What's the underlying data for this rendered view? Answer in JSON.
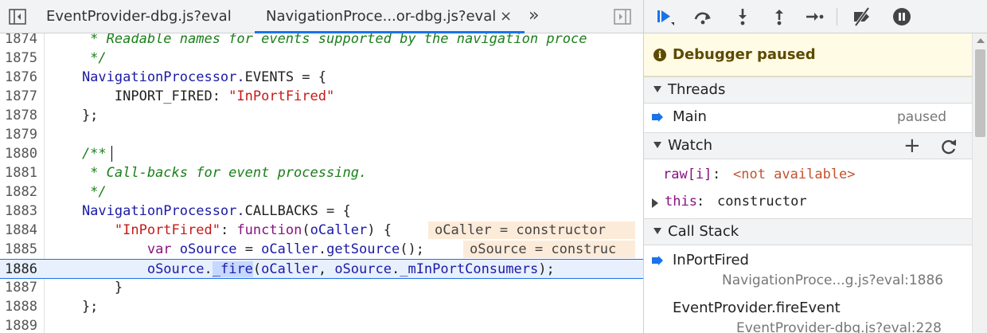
{
  "editor": {
    "tabs": [
      {
        "label": "EventProvider-dbg.js?eval",
        "active": false
      },
      {
        "label": "NavigationProce...or-dbg.js?eval",
        "active": true
      }
    ],
    "close_glyph": "×",
    "more_glyph": "»",
    "lines": [
      {
        "num": "1874",
        "segments": [
          {
            "t": "     * Readable names for events supported by the navigation proce",
            "c": "c-comment"
          }
        ]
      },
      {
        "num": "1875",
        "segments": [
          {
            "t": "     */",
            "c": "c-comment"
          }
        ]
      },
      {
        "num": "1876",
        "segments": [
          {
            "t": "    NavigationProcessor.",
            "c": "c-prop"
          },
          {
            "t": "EVENTS",
            "c": ""
          },
          {
            "t": " = {",
            "c": ""
          }
        ]
      },
      {
        "num": "1877",
        "segments": [
          {
            "t": "        INPORT_FIRED: ",
            "c": ""
          },
          {
            "t": "\"InPortFired\"",
            "c": "c-string"
          }
        ]
      },
      {
        "num": "1878",
        "segments": [
          {
            "t": "    };",
            "c": ""
          }
        ]
      },
      {
        "num": "1879",
        "segments": []
      },
      {
        "num": "1880",
        "segments": [
          {
            "t": "    /**",
            "c": "c-comment"
          }
        ]
      },
      {
        "num": "1881",
        "segments": [
          {
            "t": "     * Call-backs for event processing.",
            "c": "c-comment"
          }
        ]
      },
      {
        "num": "1882",
        "segments": [
          {
            "t": "     */",
            "c": "c-comment"
          }
        ]
      },
      {
        "num": "1883",
        "segments": [
          {
            "t": "    NavigationProcessor.",
            "c": "c-prop"
          },
          {
            "t": "CALLBACKS",
            "c": ""
          },
          {
            "t": " = {",
            "c": ""
          }
        ]
      },
      {
        "num": "1884",
        "segments": [
          {
            "t": "        ",
            "c": ""
          },
          {
            "t": "\"InPortFired\"",
            "c": "c-string"
          },
          {
            "t": ": ",
            "c": ""
          },
          {
            "t": "function",
            "c": "c-keyword"
          },
          {
            "t": "(",
            "c": ""
          },
          {
            "t": "oCaller",
            "c": "c-var"
          },
          {
            "t": ") {",
            "c": ""
          }
        ]
      },
      {
        "num": "1885",
        "segments": [
          {
            "t": "            ",
            "c": ""
          },
          {
            "t": "var",
            "c": "c-keyword"
          },
          {
            "t": " ",
            "c": ""
          },
          {
            "t": "oSource",
            "c": "c-var"
          },
          {
            "t": " = ",
            "c": ""
          },
          {
            "t": "oCaller",
            "c": "c-var"
          },
          {
            "t": ".",
            "c": ""
          },
          {
            "t": "getSource",
            "c": "c-fn"
          },
          {
            "t": "();",
            "c": ""
          }
        ]
      },
      {
        "num": "1886",
        "segments": [
          {
            "t": "            ",
            "c": ""
          },
          {
            "t": "oSource",
            "c": "c-var"
          },
          {
            "t": ".",
            "c": ""
          },
          {
            "t": "_fire",
            "c": "c-fn hl-token"
          },
          {
            "t": "(",
            "c": ""
          },
          {
            "t": "oCaller",
            "c": "c-var"
          },
          {
            "t": ", ",
            "c": ""
          },
          {
            "t": "oSource",
            "c": "c-var"
          },
          {
            "t": ".",
            "c": ""
          },
          {
            "t": "_mInPortConsumers",
            "c": "c-fn"
          },
          {
            "t": ");",
            "c": ""
          }
        ]
      },
      {
        "num": "1887",
        "segments": [
          {
            "t": "        }",
            "c": ""
          }
        ]
      },
      {
        "num": "1888",
        "segments": [
          {
            "t": "    };",
            "c": ""
          }
        ]
      },
      {
        "num": "1889",
        "segments": []
      }
    ],
    "current_line": "1886",
    "inline_values": [
      {
        "line": "1884",
        "text": "oCaller = constructor"
      },
      {
        "line": "1885",
        "text": "oSource = construc"
      }
    ]
  },
  "debugger": {
    "banner": "Debugger paused",
    "banner_icon": "i",
    "threads": {
      "header": "Threads",
      "items": [
        {
          "name": "Main",
          "status": "paused"
        }
      ]
    },
    "watch": {
      "header": "Watch",
      "add_glyph": "+",
      "items": [
        {
          "name": "raw[i]",
          "sep": ": ",
          "value": "<not available>",
          "expandable": false
        },
        {
          "name": "this",
          "sep": ": ",
          "value": "constructor",
          "expandable": true
        }
      ]
    },
    "call_stack": {
      "header": "Call Stack",
      "frames": [
        {
          "fn": "InPortFired",
          "location": "NavigationProce...g.js?eval:1886",
          "current": true
        },
        {
          "fn": "EventProvider.fireEvent",
          "location": "EventProvider-dbg.js?eval:228",
          "current": false
        }
      ]
    }
  },
  "colors": {
    "accent": "#1a73e8",
    "banner_bg": "#fffbe5",
    "banner_text": "#5c4a00"
  }
}
